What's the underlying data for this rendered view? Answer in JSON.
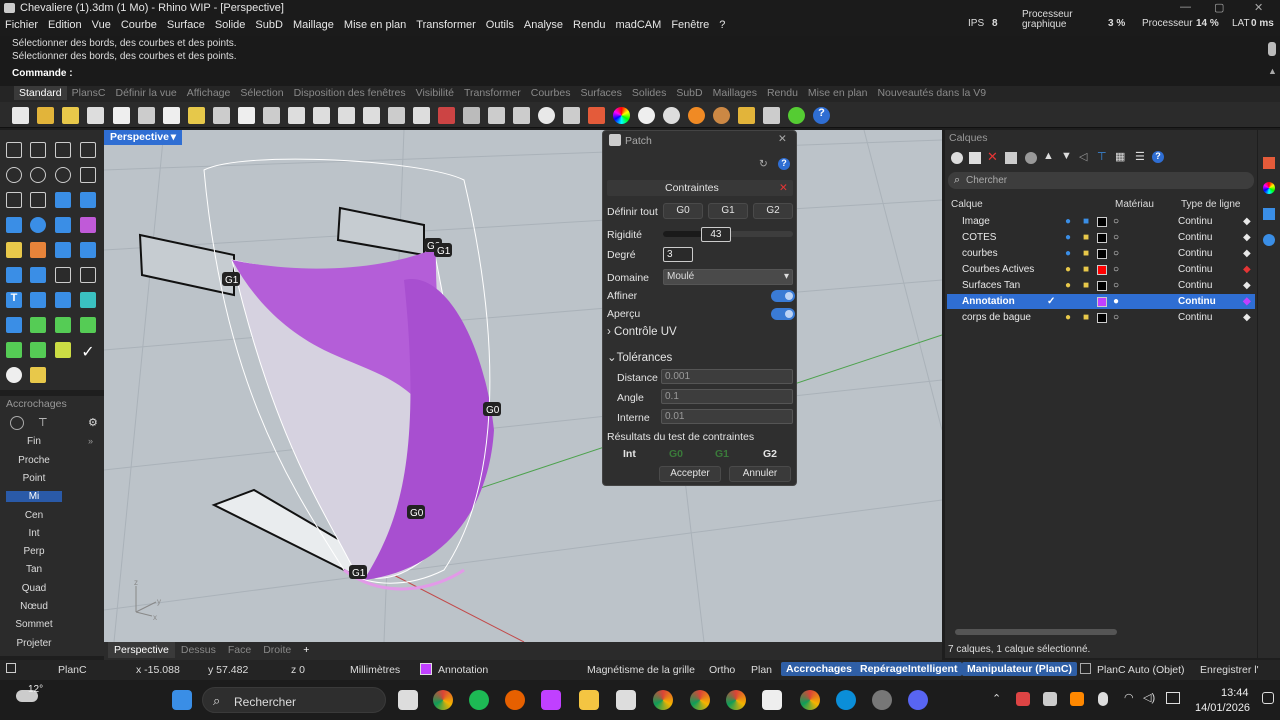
{
  "window": {
    "title": "Chevaliere (1).3dm (1 Mo) - Rhino WIP - [Perspective]"
  },
  "menu": [
    "Fichier",
    "Edition",
    "Vue",
    "Courbe",
    "Surface",
    "Solide",
    "SubD",
    "Maillage",
    "Mise en plan",
    "Transformer",
    "Outils",
    "Analyse",
    "Rendu",
    "madCAM",
    "Fenêtre",
    "?"
  ],
  "perf": {
    "ips_label": "IPS",
    "ips": "8",
    "gpu_label": "Processeur graphique",
    "gpu": "3 %",
    "cpu_label": "Processeur",
    "cpu": "14 %",
    "lat_label": "LAT",
    "lat": "0 ms"
  },
  "command": {
    "line1": "Sélectionner des bords, des courbes et des points.",
    "line2": "Sélectionner des bords, des courbes et des points.",
    "prompt": "Commande :"
  },
  "tabs": [
    "Standard",
    "PlansC",
    "Définir la vue",
    "Affichage",
    "Sélection",
    "Disposition des fenêtres",
    "Visibilité",
    "Transformer",
    "Courbes",
    "Surfaces",
    "Solides",
    "SubD",
    "Maillages",
    "Rendu",
    "Mise en plan",
    "Nouveautés dans la V9"
  ],
  "snaps": {
    "title": "Accrochages",
    "items": [
      "Fin",
      "Proche",
      "Point",
      "Mi",
      "Cen",
      "Int",
      "Perp",
      "Tan",
      "Quad",
      "Nœud",
      "Sommet",
      "Projeter"
    ],
    "active": "Mi"
  },
  "viewport": {
    "name": "Perspective",
    "labels": [
      "G1",
      "G0",
      "G1",
      "G0",
      "G0",
      "G1"
    ],
    "axes": [
      "z",
      "y",
      "x"
    ]
  },
  "viewtabs": [
    "Perspective",
    "Dessus",
    "Face",
    "Droite",
    "+"
  ],
  "patch": {
    "title": "Patch",
    "section": "Contraintes",
    "define_all": "Définir tout",
    "g0": "G0",
    "g1": "G1",
    "g2": "G2",
    "rigidity_label": "Rigidité",
    "rigidity": "43",
    "rigidity_level": 0.43,
    "degree_label": "Degré",
    "degree": "3",
    "domain_label": "Domaine",
    "domain": "Moulé",
    "refine": "Affiner",
    "preview": "Aperçu",
    "uv": "Contrôle UV",
    "tol": "Tolérances",
    "dist_label": "Distance",
    "dist": "0.001",
    "angle_label": "Angle",
    "angle": "0.1",
    "internal_label": "Interne",
    "internal": "0.01",
    "results": "Résultats du test de contraintes",
    "res_int": "Int",
    "res_g0": "G0",
    "res_g1": "G1",
    "res_g2": "G2",
    "accept": "Accepter",
    "cancel": "Annuler"
  },
  "layers": {
    "title": "Calques",
    "search_placeholder": "Chercher",
    "col_layer": "Calque",
    "col_material": "Matériau",
    "col_linetype": "Type de ligne",
    "rows": [
      {
        "name": "Image",
        "color": "#000000",
        "linetype": "Continu"
      },
      {
        "name": "COTES",
        "color": "#000000",
        "linetype": "Continu"
      },
      {
        "name": "courbes",
        "color": "#000000",
        "linetype": "Continu"
      },
      {
        "name": "Courbes Actives",
        "color": "#ff0000",
        "linetype": "Continu"
      },
      {
        "name": "Surfaces Tan",
        "color": "#000000",
        "linetype": "Continu"
      },
      {
        "name": "Annotation",
        "color": "#c040ff",
        "linetype": "Continu"
      },
      {
        "name": "corps de bague",
        "color": "#000000",
        "linetype": "Continu"
      }
    ],
    "status": "7 calques, 1 calque sélectionné."
  },
  "status": {
    "plane": "PlanC",
    "x": "x -15.088",
    "y": "y 57.482",
    "z": "z 0",
    "units": "Millimètres",
    "layer": "Annotation",
    "grid": "Magnétisme de la grille",
    "ortho": "Ortho",
    "plan": "Plan",
    "snaps": "Accrochages",
    "smart": "RepérageIntelligent",
    "gumball": "Manipulateur (PlanC)",
    "auto": "PlanC Auto (Objet)",
    "save": "Enregistrer l'"
  },
  "taskbar": {
    "temp": "12°",
    "search": "Rechercher",
    "time": "13:44",
    "date": "14/01/2026"
  }
}
